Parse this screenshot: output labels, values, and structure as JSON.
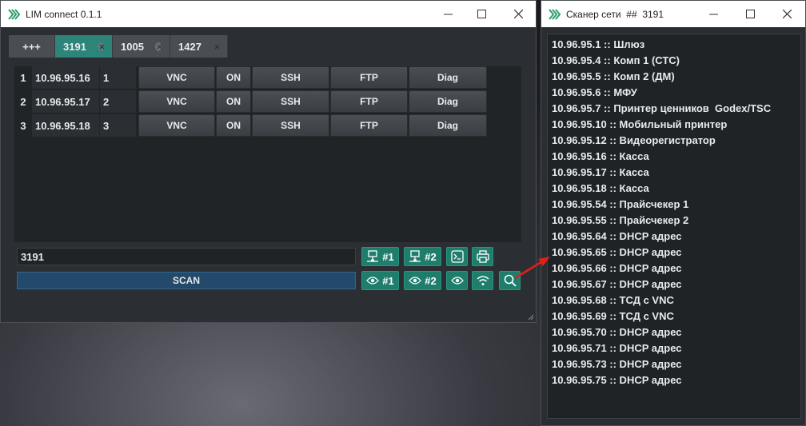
{
  "main_window": {
    "title": "LIM connect 0.1.1",
    "tabs": [
      {
        "label": "+++",
        "active": false,
        "closable": false
      },
      {
        "label": "3191",
        "active": true,
        "closable": true
      },
      {
        "label": "1005",
        "active": false,
        "closable": true
      },
      {
        "label": "1427",
        "active": false,
        "closable": true
      }
    ],
    "rows": [
      {
        "num": "1",
        "ip": "10.96.95.16",
        "count": "1",
        "vnc": "VNC",
        "on": "ON",
        "ssh": "SSH",
        "ftp": "FTP",
        "diag": "Diag"
      },
      {
        "num": "2",
        "ip": "10.96.95.17",
        "count": "2",
        "vnc": "VNC",
        "on": "ON",
        "ssh": "SSH",
        "ftp": "FTP",
        "diag": "Diag"
      },
      {
        "num": "3",
        "ip": "10.96.95.18",
        "count": "3",
        "vnc": "VNC",
        "on": "ON",
        "ssh": "SSH",
        "ftp": "FTP",
        "diag": "Diag"
      }
    ],
    "code_input_value": "3191",
    "scan_label": "SCAN",
    "net_btn_1": "#1",
    "net_btn_2": "#2",
    "view_btn_1": "#1",
    "view_btn_2": "#2"
  },
  "scanner_window": {
    "title": "Сканер сети  ##  3191",
    "entries": [
      "10.96.95.1 :: Шлюз",
      "10.96.95.4 :: Комп 1 (СТС)",
      "10.96.95.5 :: Комп 2 (ДМ)",
      "10.96.95.6 :: МФУ",
      "10.96.95.7 :: Принтер ценников  Godex/TSC",
      "10.96.95.10 :: Мобильный принтер",
      "10.96.95.12 :: Видеорегистратор",
      "10.96.95.16 :: Касса",
      "10.96.95.17 :: Касса",
      "10.96.95.18 :: Касса",
      "10.96.95.54 :: Прайсчекер 1",
      "10.96.95.55 :: Прайсчекер 2",
      "10.96.95.64 :: DHCP адрес",
      "10.96.95.65 :: DHCP адрес",
      "10.96.95.66 :: DHCP адрес",
      "10.96.95.67 :: DHCP адрес",
      "10.96.95.68 :: ТСД с VNC",
      "10.96.95.69 :: ТСД с VNC",
      "10.96.95.70 :: DHCP адрес",
      "10.96.95.71 :: DHCP адрес",
      "10.96.95.73 :: DHCP адрес",
      "10.96.95.75 :: DHCP адрес"
    ]
  },
  "colors": {
    "accent_teal": "#2d8479",
    "button_green": "#1f7d6c",
    "scan_blue": "#234a6a",
    "arrow_red": "#e0201a"
  },
  "icons": [
    "app-logo-icon",
    "minimize-icon",
    "maximize-icon",
    "close-icon",
    "network-icon",
    "terminal-icon",
    "printer-icon",
    "eye-icon",
    "wifi-icon",
    "search-icon"
  ]
}
